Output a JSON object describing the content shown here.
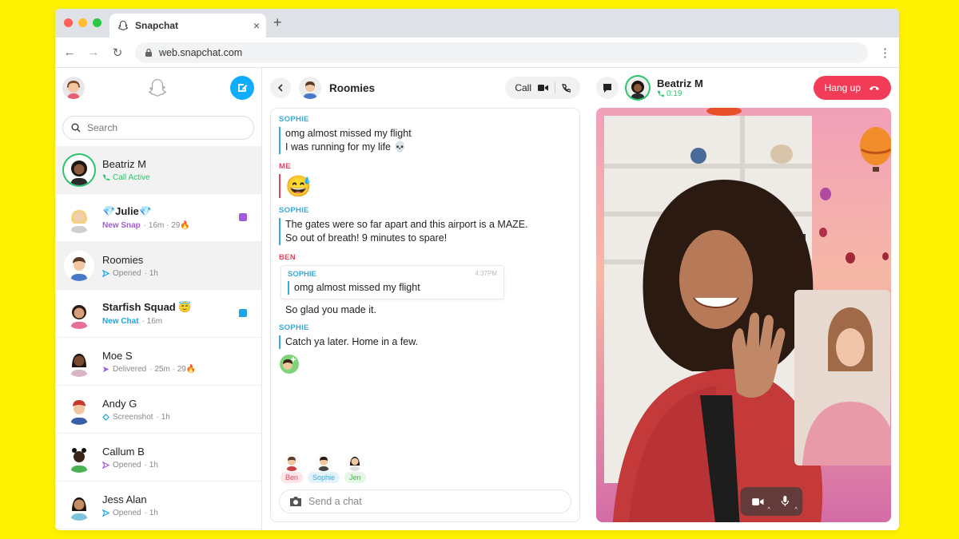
{
  "browser": {
    "tab_title": "Snapchat",
    "tab_close": "×",
    "new_tab": "+",
    "url": "web.snapchat.com",
    "back": "←",
    "forward": "→",
    "reload": "↻",
    "menu": "⋮"
  },
  "sidebar": {
    "search_placeholder": "Search",
    "chats": [
      {
        "name": "Beatriz M",
        "status": "Call Active",
        "status_color": "#2bc46e",
        "icon": "phone-icon",
        "meta": ""
      },
      {
        "name": "💎Julie💎",
        "status": "New Snap",
        "status_color": "#a05cd6",
        "icon": "",
        "meta": "· 16m · 29🔥"
      },
      {
        "name": "Roomies",
        "status": "Opened",
        "status_color": "#888888",
        "icon": "sent-arrow-icon",
        "meta": "· 1h"
      },
      {
        "name": "Starfish Squad 😇",
        "status": "New Chat",
        "status_color": "#1aa6e8",
        "icon": "",
        "meta": "· 16m"
      },
      {
        "name": "Moe S",
        "status": "Delivered",
        "status_color": "#888888",
        "icon": "sent-arrow-icon",
        "meta": "· 25m · 29🔥"
      },
      {
        "name": "Andy G",
        "status": "Screenshot",
        "status_color": "#888888",
        "icon": "screenshot-icon",
        "meta": "· 1h"
      },
      {
        "name": "Callum B",
        "status": "Opened",
        "status_color": "#888888",
        "icon": "sent-arrow-icon",
        "meta": "· 1h"
      },
      {
        "name": "Jess Alan",
        "status": "Opened",
        "status_color": "#888888",
        "icon": "sent-arrow-icon",
        "meta": "· 1h"
      }
    ]
  },
  "chat": {
    "title": "Roomies",
    "call_label": "Call",
    "messages": {
      "m1_sender": "SOPHIE",
      "m1_line1": "omg almost missed my flight",
      "m1_line2": "I was running for my life 💀",
      "m2_sender": "ME",
      "m2_emoji": "😅",
      "m3_sender": "SOPHIE",
      "m3_line1": "The gates were so far apart and this airport is a MAZE.",
      "m3_line2": "So out of breath! 9 minutes to spare!",
      "m4_sender": "BEN",
      "m4_quote_sender": "SOPHIE",
      "m4_quote_time": "4:37PM",
      "m4_quote_text": "omg almost missed my flight",
      "m4_text": "So glad you made it.",
      "m5_sender": "SOPHIE",
      "m5_text": "Catch ya later. Home in a few."
    },
    "typers": [
      "Ben",
      "Sophie",
      "Jen"
    ],
    "compose_placeholder": "Send a chat"
  },
  "call": {
    "caller": "Beatriz M",
    "duration": "0:19",
    "hangup_label": "Hang up"
  },
  "colors": {
    "accent_yellow": "#fff200",
    "blue": "#3aa8d8",
    "red": "#e0455e",
    "green": "#2bc46e",
    "hangup": "#f23c57"
  }
}
